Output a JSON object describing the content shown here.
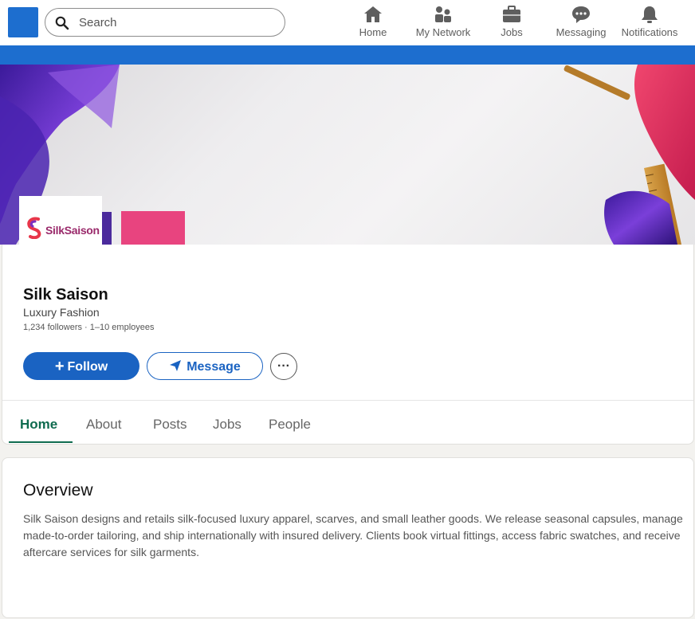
{
  "search": {
    "placeholder": "Search"
  },
  "nav": {
    "items": [
      {
        "label": "Home",
        "icon": "home-icon"
      },
      {
        "label": "My Network",
        "icon": "network-icon"
      },
      {
        "label": "Jobs",
        "icon": "briefcase-icon"
      },
      {
        "label": "Messaging",
        "icon": "chat-icon"
      },
      {
        "label": "Notifications",
        "icon": "bell-icon"
      }
    ]
  },
  "colors": {
    "brand": "#1d6ecf",
    "primary_button": "#1a63c2",
    "active_tab": "#0f6b4f"
  },
  "company": {
    "logo_text": "SilkSaison",
    "name": "Silk Saison",
    "tagline": "Luxury Fashion",
    "meta": "1,234 followers · 1–10 employees"
  },
  "actions": {
    "follow": "Follow",
    "message": "Message",
    "more": "···"
  },
  "tabs": [
    {
      "label": "Home",
      "active": true
    },
    {
      "label": "About",
      "active": false
    },
    {
      "label": "Posts",
      "active": false
    },
    {
      "label": "Jobs",
      "active": false
    },
    {
      "label": "People",
      "active": false
    }
  ],
  "overview": {
    "title": "Overview",
    "text": "Silk Saison designs and retails silk-focused luxury apparel, scarves, and small leather goods. We release seasonal capsules, manage made-to-order tailoring, and ship internationally with insured delivery. Clients book virtual fittings, access fabric swatches, and receive aftercare services for silk garments."
  }
}
